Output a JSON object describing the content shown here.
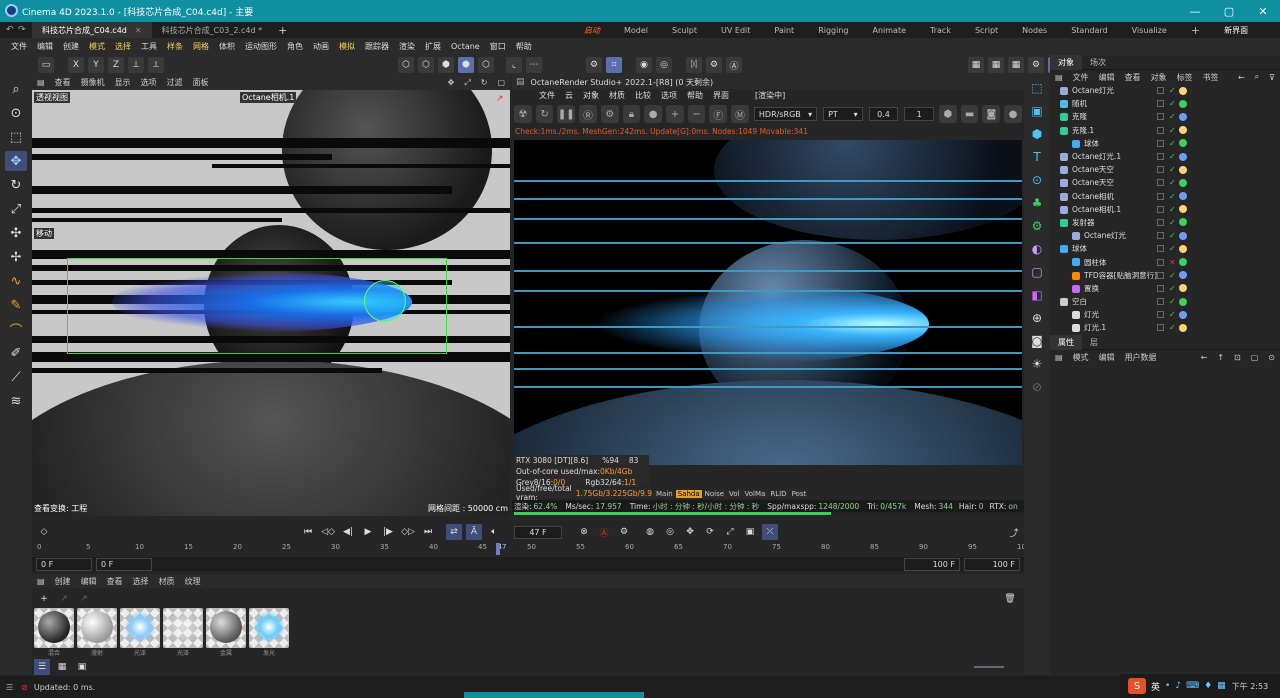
{
  "window": {
    "title": "Cinema 4D 2023.1.0 - [科技芯片合成_C04.c4d] - 主要",
    "min": "—",
    "max": "▢",
    "close": "✕"
  },
  "docs": [
    {
      "label": "科技芯片合成_C04.c4d",
      "close": "✕"
    },
    {
      "label": "科技芯片合成_C03_2.c4d *"
    }
  ],
  "add_tab": "+",
  "workspaces": [
    "启动",
    "Model",
    "Sculpt",
    "UV Edit",
    "Paint",
    "Rigging",
    "Animate",
    "Track",
    "Script",
    "Nodes",
    "Standard",
    "Visualize"
  ],
  "ws_add": "+",
  "new_layout": "新界面",
  "menus": [
    "文件",
    "编辑",
    "创建",
    "模式",
    "选择",
    "工具",
    "样条",
    "网格",
    "体积",
    "运动图形",
    "角色",
    "动画",
    "模拟",
    "跟踪器",
    "渲染",
    "扩展",
    "Octane",
    "窗口",
    "帮助"
  ],
  "toolbar": {
    "axes": [
      "X",
      "Y",
      "Z"
    ]
  },
  "viewport": {
    "menu": [
      "查看",
      "摄像机",
      "显示",
      "选项",
      "过滤",
      "面板"
    ],
    "label_tl": "透视视图",
    "label_cam": "Octane相机.1",
    "label_move": "移动",
    "footer_left": "查看变换: 工程",
    "footer_right": "网格间距 : 50000 cm"
  },
  "render": {
    "title": "OctaneRender Studio+  2022.1-[R8] (0 天剩余)",
    "menu": [
      "文件",
      "云",
      "对象",
      "材质",
      "比较",
      "选项",
      "帮助",
      "界面"
    ],
    "status_cn": "[渲染中]",
    "colorspace": "HDR/sRGB",
    "mode": "PT",
    "v1": "0.4",
    "v2": "1",
    "check": "Check:1ms./2ms. MeshGen:242ms. Update[G]:0ms. Nodes:1049 Movable:341",
    "info": {
      "gpu": "RTX 3080 [DT][8.6]",
      "pct": "%94",
      "temp": "83",
      "ooc_label": "Out-of-core used/max:",
      "ooc_val": "0Kb/4Gb",
      "grey_label": "Grey8/16:",
      "grey_val": "0/0",
      "rgb_label": "Rgb32/64:",
      "rgb_val": "1/1",
      "vram_label": "Used/free/total vram:",
      "vram_val": "1.75Gb/3.225Gb/9.9"
    },
    "passes": [
      "Main",
      "Sahda",
      "Noise",
      "Vol",
      "VolMa",
      "RLID",
      "Post"
    ],
    "bottom": {
      "l1": "渲染:",
      "v1": "62.4%",
      "l2": "Ms/sec:",
      "v2": "17.957",
      "l3": "Time:",
      "v3": "小时 : 分钟 : 秒/小时 : 分钟 : 秒",
      "l4": "Spp/maxspp:",
      "v4": "1248/2000",
      "l5": "Tri:",
      "v5": "0/457k",
      "l6": "Mesh:",
      "v6": "344",
      "l7": "Hair:",
      "v7": "0",
      "l8": "RTX:",
      "v8": "on"
    },
    "progress": 0.624
  },
  "timeline": {
    "frame": "47 F",
    "start": "0 F",
    "start2": "0 F",
    "end": "100 F",
    "end2": "100 F",
    "ticks": [
      "0",
      "5",
      "10",
      "15",
      "20",
      "25",
      "30",
      "35",
      "40",
      "45",
      "47",
      "50",
      "55",
      "60",
      "65",
      "70",
      "75",
      "80",
      "85",
      "90",
      "95",
      "100"
    ],
    "current": 47
  },
  "materials": {
    "menu": [
      "创建",
      "编辑",
      "查看",
      "选择",
      "材质",
      "纹理"
    ],
    "items": [
      {
        "name": "混合"
      },
      {
        "name": "漫射"
      },
      {
        "name": "光泽"
      },
      {
        "name": "光泽"
      },
      {
        "name": "金属"
      },
      {
        "name": "发光"
      }
    ]
  },
  "status": "Updated: 0 ms.",
  "objects": {
    "tabs": [
      "对象",
      "场次"
    ],
    "menu": [
      "文件",
      "编辑",
      "查看",
      "对象",
      "标签",
      "书签"
    ],
    "rows": [
      {
        "name": "Octane灯光",
        "ind": 0,
        "color": "#9ad"
      },
      {
        "name": "随机",
        "ind": 0,
        "color": "#5be"
      },
      {
        "name": "克隆",
        "ind": 0,
        "color": "#3c9"
      },
      {
        "name": "克隆.1",
        "ind": 0,
        "color": "#3c9"
      },
      {
        "name": "球体",
        "ind": 1,
        "color": "#4af"
      },
      {
        "name": "Octane灯光.1",
        "ind": 0,
        "color": "#9ad"
      },
      {
        "name": "Octane天空",
        "ind": 0,
        "color": "#9ad"
      },
      {
        "name": "Octane天空",
        "ind": 0,
        "color": "#9ad"
      },
      {
        "name": "Octane相机",
        "ind": 0,
        "color": "#9ad"
      },
      {
        "name": "Octane相机.1",
        "ind": 0,
        "color": "#9ad"
      },
      {
        "name": "发射器",
        "ind": 0,
        "color": "#3c9"
      },
      {
        "name": "Octane灯光",
        "ind": 1,
        "color": "#9ad"
      },
      {
        "name": "球体",
        "ind": 0,
        "color": "#4af"
      },
      {
        "name": "圆柱体",
        "ind": 1,
        "color": "#4af"
      },
      {
        "name": "TFD容器[贴脑洞意行]",
        "ind": 1,
        "color": "#f80"
      },
      {
        "name": "置换",
        "ind": 1,
        "color": "#c6f"
      },
      {
        "name": "空白",
        "ind": 0,
        "color": "#ccc"
      },
      {
        "name": "灯光",
        "ind": 1,
        "color": "#ddd"
      },
      {
        "name": "灯光.1",
        "ind": 1,
        "color": "#ddd"
      }
    ]
  },
  "attributes": {
    "tabs": [
      "属性",
      "层"
    ],
    "menu": [
      "模式",
      "编辑",
      "用户数据"
    ]
  },
  "ime": {
    "label": "英",
    "time": "下午 2:53"
  }
}
